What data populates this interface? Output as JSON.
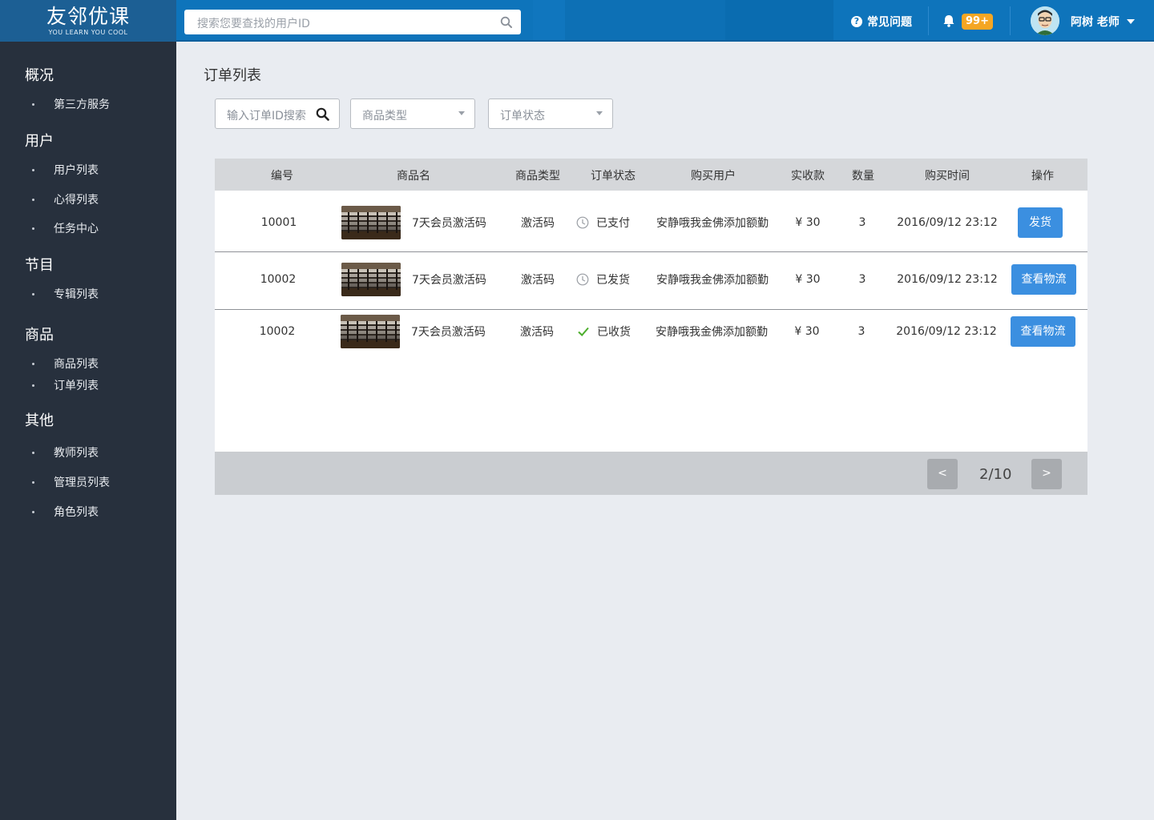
{
  "header": {
    "logo_main": "友邻优课",
    "logo_sub": "YOU LEARN YOU COOL",
    "search_placeholder": "搜索您要查找的用户ID",
    "faq_label": "常见问题",
    "notification_count": "99+",
    "user_name": "阿树 老师"
  },
  "sidebar": {
    "sections": [
      {
        "title": "概况",
        "items": [
          "第三方服务"
        ]
      },
      {
        "title": "用户",
        "items": [
          "用户列表",
          "心得列表",
          "任务中心"
        ]
      },
      {
        "title": "节目",
        "items": [
          "专辑列表"
        ]
      },
      {
        "title": "商品",
        "items": [
          "商品列表",
          "订单列表"
        ]
      },
      {
        "title": "其他",
        "items": [
          "教师列表",
          "管理员列表",
          "角色列表"
        ]
      }
    ]
  },
  "main": {
    "title": "订单列表",
    "filters": {
      "order_search_placeholder": "输入订单ID搜索",
      "product_type_placeholder": "商品类型",
      "order_status_placeholder": "订单状态"
    },
    "table": {
      "columns": [
        "编号",
        "商品名",
        "商品类型",
        "订单状态",
        "购买用户",
        "实收款",
        "数量",
        "购买时间",
        "操作"
      ],
      "rows": [
        {
          "id": "10001",
          "product": "7天会员激活码",
          "type": "激活码",
          "status": "已支付",
          "status_icon": "clock-icon",
          "user": "安静哦我金佛添加额勤",
          "amount": "¥ 30",
          "qty": "3",
          "time": "2016/09/12  23:12",
          "action": "发货"
        },
        {
          "id": "10002",
          "product": "7天会员激活码",
          "type": "激活码",
          "status": "已发货",
          "status_icon": "clock-icon",
          "user": "安静哦我金佛添加额勤",
          "amount": "¥ 30",
          "qty": "3",
          "time": "2016/09/12  23:12",
          "action": "查看物流"
        },
        {
          "id": "10002",
          "product": "7天会员激活码",
          "type": "激活码",
          "status": "已收货",
          "status_icon": "check-icon",
          "user": "安静哦我金佛添加额勤",
          "amount": "¥ 30",
          "qty": "3",
          "time": "2016/09/12  23:12",
          "action": "查看物流"
        }
      ]
    },
    "pagination": {
      "prev": "<",
      "page": "2/10",
      "next": ">"
    }
  },
  "colors": {
    "topbar": "#0e74bb",
    "sidebar": "#27303d",
    "button": "#3b8fe0",
    "badge": "#f5a623",
    "check": "#4cae2c"
  }
}
